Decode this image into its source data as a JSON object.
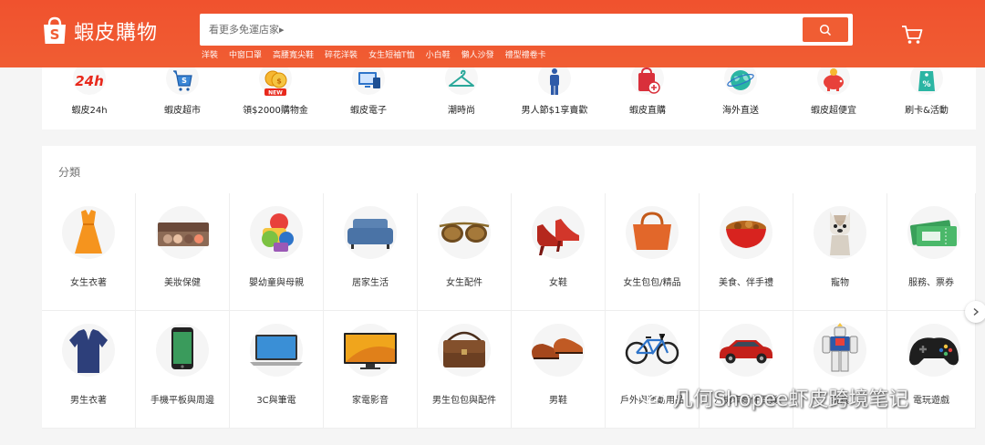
{
  "brand": {
    "logo_text": "蝦皮購物",
    "logo_mark": "S",
    "accent_color": "#f05d33"
  },
  "search": {
    "placeholder": "看更多免運店家▸",
    "button_icon": "search-icon"
  },
  "hot_words": [
    "洋裝",
    "中窗口罩",
    "高腰寬尖鞋",
    "碎花洋裝",
    "女生短袖T恤",
    "小白鞋",
    "懶人沙發",
    "禮型禮卷卡"
  ],
  "cart": {
    "icon": "cart-icon"
  },
  "quick_links": [
    {
      "label": "蝦皮24h",
      "icon": "24h-icon"
    },
    {
      "label": "蝦皮超市",
      "icon": "supermarket-cart-icon"
    },
    {
      "label": "領$2000購物金",
      "icon": "coins-new-icon"
    },
    {
      "label": "蝦皮電子",
      "icon": "devices-icon"
    },
    {
      "label": "潮時尚",
      "icon": "hanger-icon"
    },
    {
      "label": "男人節$1享賣歡",
      "icon": "man-icon"
    },
    {
      "label": "蝦皮直購",
      "icon": "bag-plus-icon"
    },
    {
      "label": "海外直送",
      "icon": "globe-icon"
    },
    {
      "label": "蝦皮超便宜",
      "icon": "piggy-bank-icon"
    },
    {
      "label": "刷卡&活動",
      "icon": "discount-tag-icon"
    }
  ],
  "categories_section": {
    "title": "分類",
    "items": [
      {
        "label": "女生衣著",
        "icon": "dress-icon"
      },
      {
        "label": "美妝保健",
        "icon": "eyeshadow-palette-icon"
      },
      {
        "label": "嬰幼童與母親",
        "icon": "baby-toys-icon"
      },
      {
        "label": "居家生活",
        "icon": "sofa-icon"
      },
      {
        "label": "女生配件",
        "icon": "sunglasses-icon"
      },
      {
        "label": "女鞋",
        "icon": "high-heels-icon"
      },
      {
        "label": "女生包包/精品",
        "icon": "handbag-icon"
      },
      {
        "label": "美食、伴手禮",
        "icon": "food-bowl-icon"
      },
      {
        "label": "寵物",
        "icon": "dog-icon"
      },
      {
        "label": "服務、票券",
        "icon": "tickets-icon"
      },
      {
        "label": "男生衣著",
        "icon": "polo-shirt-icon"
      },
      {
        "label": "手機平板與周邊",
        "icon": "smartphone-icon"
      },
      {
        "label": "3C與筆電",
        "icon": "laptop-icon"
      },
      {
        "label": "家電影音",
        "icon": "tv-icon"
      },
      {
        "label": "男生包包與配件",
        "icon": "messenger-bag-icon"
      },
      {
        "label": "男鞋",
        "icon": "leather-shoes-icon"
      },
      {
        "label": "戶外與運動用品",
        "icon": "bicycle-icon"
      },
      {
        "label": "汽機車零件百貨",
        "icon": "car-icon"
      },
      {
        "label": "玩具",
        "icon": "robot-figure-icon"
      },
      {
        "label": "電玩遊戲",
        "icon": "game-controller-icon"
      }
    ]
  },
  "next_button": {
    "icon": "chevron-right-icon"
  },
  "watermark": {
    "text": "几何Shopee虾皮跨境笔记"
  }
}
